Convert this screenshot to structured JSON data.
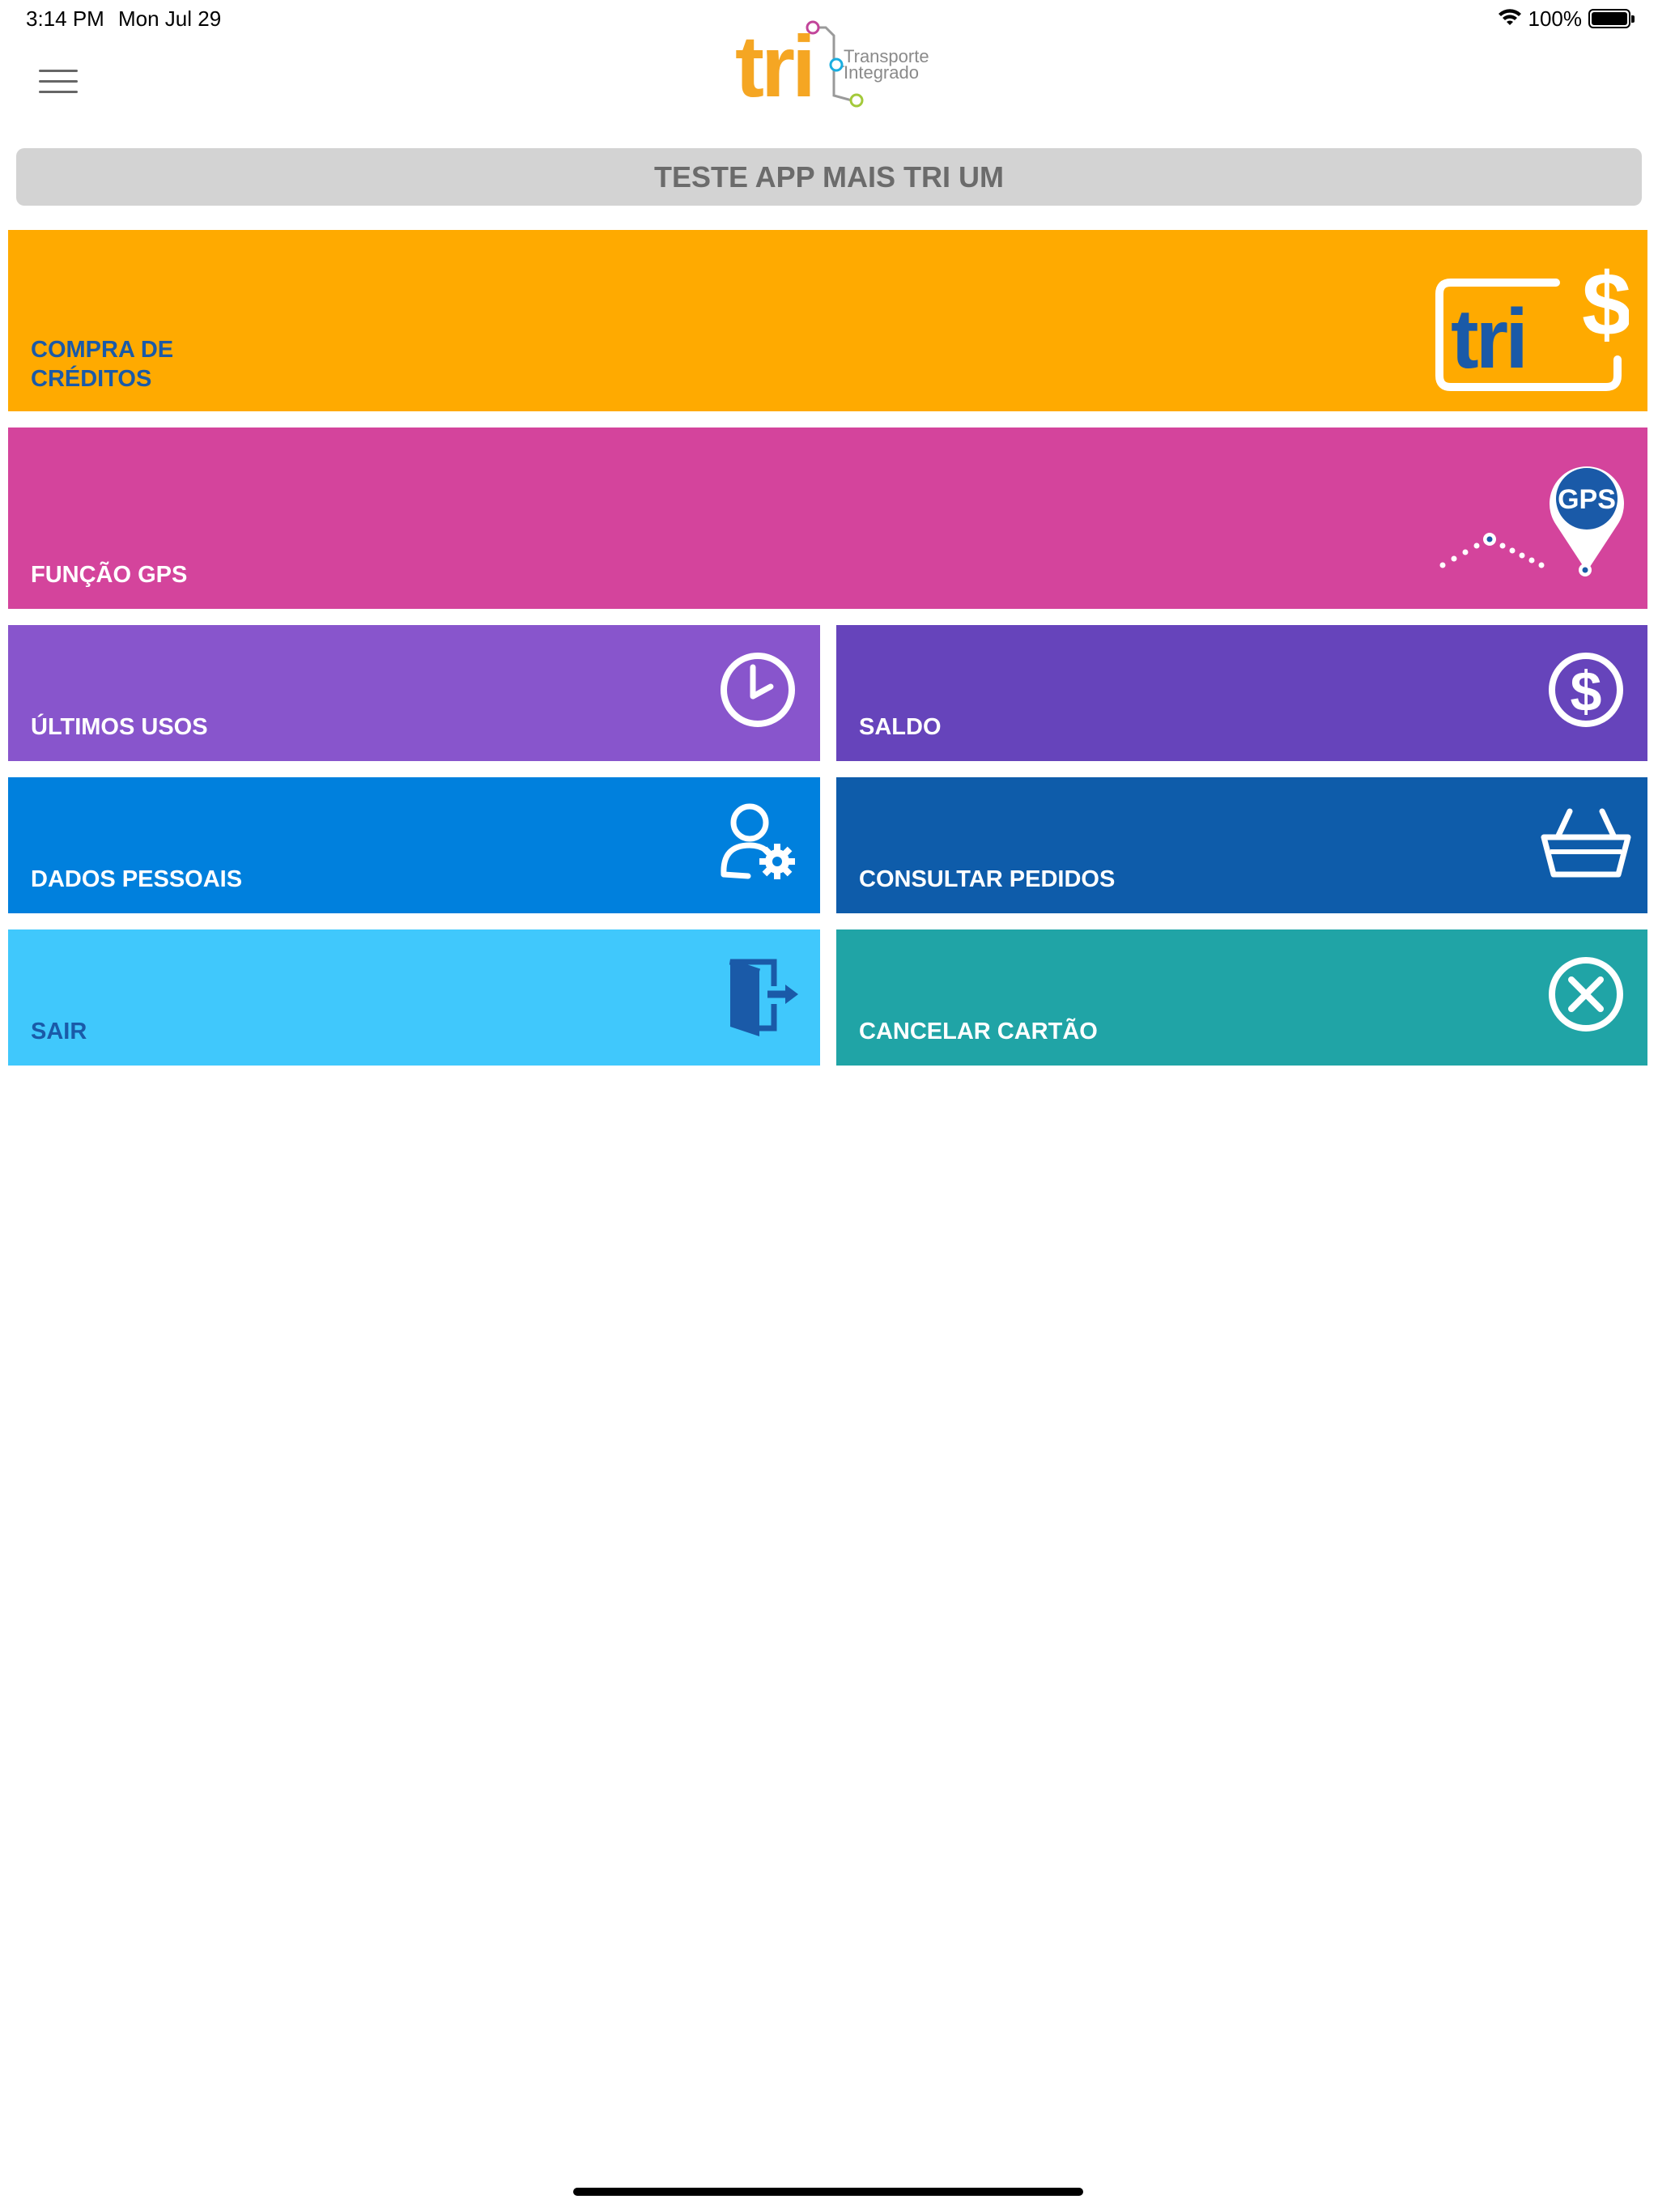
{
  "status_bar": {
    "time": "3:14 PM",
    "date": "Mon Jul 29",
    "battery": "100%"
  },
  "header": {
    "menu_icon": "hamburger-menu-icon",
    "logo": {
      "word": "tri",
      "line1": "Transporte",
      "line2": "Integrado"
    }
  },
  "account": {
    "name": "TESTE APP MAIS TRI UM"
  },
  "tiles": [
    {
      "label_line1": "COMPRA DE",
      "label_line2": "CRÉDITOS",
      "icon": "tri-card-dollar-icon",
      "color": "#ffaa00",
      "text_color": "#1a5aa8"
    },
    {
      "label": "FUNÇÃO GPS",
      "icon": "gps-pin-route-icon",
      "icon_text": "GPS",
      "color": "#d4449c",
      "text_color": "#ffffff"
    },
    {
      "label": "ÚLTIMOS USOS",
      "icon": "clock-icon",
      "color": "#8855cc",
      "text_color": "#ffffff"
    },
    {
      "label": "SALDO",
      "icon": "dollar-circle-icon",
      "color": "#6644bb",
      "text_color": "#ffffff"
    },
    {
      "label": "DADOS PESSOAIS",
      "icon": "user-settings-icon",
      "color": "#0080dd",
      "text_color": "#ffffff"
    },
    {
      "label": "CONSULTAR PEDIDOS",
      "icon": "shopping-basket-icon",
      "color": "#0e5caa",
      "text_color": "#ffffff"
    },
    {
      "label": "SAIR",
      "icon": "exit-door-icon",
      "color": "#40c8fc",
      "text_color": "#1a5aa8"
    },
    {
      "label": "CANCELAR CARTÃO",
      "icon": "cancel-circle-icon",
      "color": "#20a4a6",
      "text_color": "#ffffff"
    }
  ]
}
